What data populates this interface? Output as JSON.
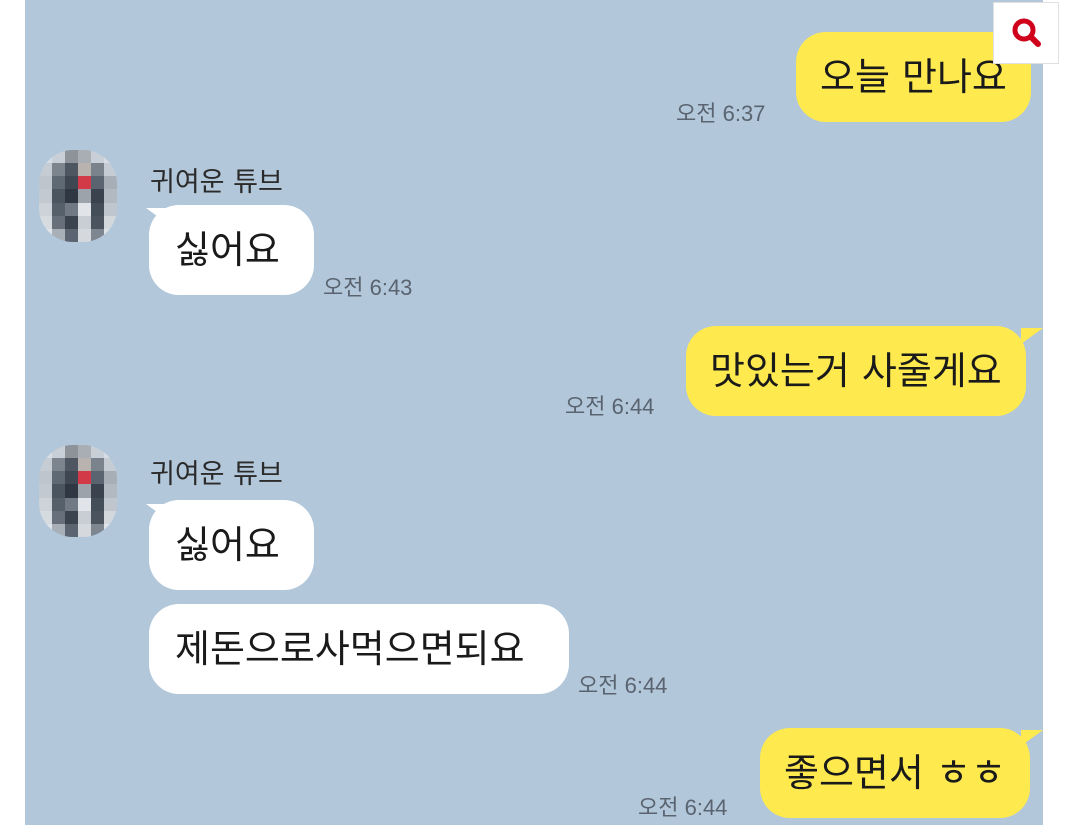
{
  "contact": {
    "name": "귀여운 튜브"
  },
  "messages": [
    {
      "sender": "me",
      "text": "오늘 만나요",
      "time": "오전 6:37"
    },
    {
      "sender": "other",
      "text": "싫어요",
      "time": "오전 6:43"
    },
    {
      "sender": "me",
      "text": "맛있는거 사줄게요",
      "time": "오전 6:44"
    },
    {
      "sender": "other",
      "text": "싫어요",
      "time": ""
    },
    {
      "sender": "other",
      "text": "제돈으로사먹으면되요",
      "time": "오전 6:44"
    },
    {
      "sender": "me",
      "text": "좋으면서 ㅎㅎ",
      "time": "오전 6:44"
    }
  ],
  "colors": {
    "chat_background": "#b2c7da",
    "my_bubble": "#fee94e",
    "other_bubble": "#ffffff",
    "search_icon": "#d0021b"
  },
  "icons": {
    "search": "search-icon"
  }
}
